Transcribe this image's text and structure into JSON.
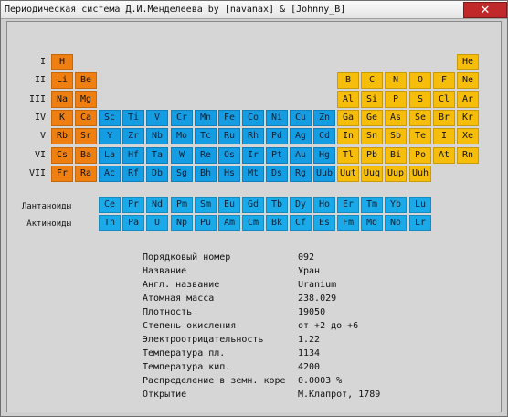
{
  "window": {
    "title": "Периодическая система Д.И.Менделеева by [navanax] & [Johnny_B]",
    "close_symbol": "✕",
    "colors": {
      "s_block": "#f07f11",
      "d_block": "#159de3",
      "p_block": "#f7bd0b",
      "f_block": "#1baae9",
      "close": "#c0282a"
    }
  },
  "period_labels": [
    "I",
    "II",
    "III",
    "IV",
    "V",
    "VI",
    "VII"
  ],
  "series_labels": {
    "lanthanides": "Лантаноиды",
    "actinides": "Актиноиды"
  },
  "elements": [
    {
      "symbol": "H",
      "period": 1,
      "group": 1,
      "block": "s"
    },
    {
      "symbol": "He",
      "period": 1,
      "group": 18,
      "block": "p"
    },
    {
      "symbol": "Li",
      "period": 2,
      "group": 1,
      "block": "s"
    },
    {
      "symbol": "Be",
      "period": 2,
      "group": 2,
      "block": "s"
    },
    {
      "symbol": "B",
      "period": 2,
      "group": 13,
      "block": "p"
    },
    {
      "symbol": "C",
      "period": 2,
      "group": 14,
      "block": "p"
    },
    {
      "symbol": "N",
      "period": 2,
      "group": 15,
      "block": "p"
    },
    {
      "symbol": "O",
      "period": 2,
      "group": 16,
      "block": "p"
    },
    {
      "symbol": "F",
      "period": 2,
      "group": 17,
      "block": "p"
    },
    {
      "symbol": "Ne",
      "period": 2,
      "group": 18,
      "block": "p"
    },
    {
      "symbol": "Na",
      "period": 3,
      "group": 1,
      "block": "s"
    },
    {
      "symbol": "Mg",
      "period": 3,
      "group": 2,
      "block": "s"
    },
    {
      "symbol": "Al",
      "period": 3,
      "group": 13,
      "block": "p"
    },
    {
      "symbol": "Si",
      "period": 3,
      "group": 14,
      "block": "p"
    },
    {
      "symbol": "P",
      "period": 3,
      "group": 15,
      "block": "p"
    },
    {
      "symbol": "S",
      "period": 3,
      "group": 16,
      "block": "p"
    },
    {
      "symbol": "Cl",
      "period": 3,
      "group": 17,
      "block": "p"
    },
    {
      "symbol": "Ar",
      "period": 3,
      "group": 18,
      "block": "p"
    },
    {
      "symbol": "K",
      "period": 4,
      "group": 1,
      "block": "s"
    },
    {
      "symbol": "Ca",
      "period": 4,
      "group": 2,
      "block": "s"
    },
    {
      "symbol": "Sc",
      "period": 4,
      "group": 3,
      "block": "d"
    },
    {
      "symbol": "Ti",
      "period": 4,
      "group": 4,
      "block": "d"
    },
    {
      "symbol": "V",
      "period": 4,
      "group": 5,
      "block": "d"
    },
    {
      "symbol": "Cr",
      "period": 4,
      "group": 6,
      "block": "d"
    },
    {
      "symbol": "Mn",
      "period": 4,
      "group": 7,
      "block": "d"
    },
    {
      "symbol": "Fe",
      "period": 4,
      "group": 8,
      "block": "d"
    },
    {
      "symbol": "Co",
      "period": 4,
      "group": 9,
      "block": "d"
    },
    {
      "symbol": "Ni",
      "period": 4,
      "group": 10,
      "block": "d"
    },
    {
      "symbol": "Cu",
      "period": 4,
      "group": 11,
      "block": "d"
    },
    {
      "symbol": "Zn",
      "period": 4,
      "group": 12,
      "block": "d"
    },
    {
      "symbol": "Ga",
      "period": 4,
      "group": 13,
      "block": "p"
    },
    {
      "symbol": "Ge",
      "period": 4,
      "group": 14,
      "block": "p"
    },
    {
      "symbol": "As",
      "period": 4,
      "group": 15,
      "block": "p"
    },
    {
      "symbol": "Se",
      "period": 4,
      "group": 16,
      "block": "p"
    },
    {
      "symbol": "Br",
      "period": 4,
      "group": 17,
      "block": "p"
    },
    {
      "symbol": "Kr",
      "period": 4,
      "group": 18,
      "block": "p"
    },
    {
      "symbol": "Rb",
      "period": 5,
      "group": 1,
      "block": "s"
    },
    {
      "symbol": "Sr",
      "period": 5,
      "group": 2,
      "block": "s"
    },
    {
      "symbol": "Y",
      "period": 5,
      "group": 3,
      "block": "d"
    },
    {
      "symbol": "Zr",
      "period": 5,
      "group": 4,
      "block": "d"
    },
    {
      "symbol": "Nb",
      "period": 5,
      "group": 5,
      "block": "d"
    },
    {
      "symbol": "Mo",
      "period": 5,
      "group": 6,
      "block": "d"
    },
    {
      "symbol": "Tc",
      "period": 5,
      "group": 7,
      "block": "d"
    },
    {
      "symbol": "Ru",
      "period": 5,
      "group": 8,
      "block": "d"
    },
    {
      "symbol": "Rh",
      "period": 5,
      "group": 9,
      "block": "d"
    },
    {
      "symbol": "Pd",
      "period": 5,
      "group": 10,
      "block": "d"
    },
    {
      "symbol": "Ag",
      "period": 5,
      "group": 11,
      "block": "d"
    },
    {
      "symbol": "Cd",
      "period": 5,
      "group": 12,
      "block": "d"
    },
    {
      "symbol": "In",
      "period": 5,
      "group": 13,
      "block": "p"
    },
    {
      "symbol": "Sn",
      "period": 5,
      "group": 14,
      "block": "p"
    },
    {
      "symbol": "Sb",
      "period": 5,
      "group": 15,
      "block": "p"
    },
    {
      "symbol": "Te",
      "period": 5,
      "group": 16,
      "block": "p"
    },
    {
      "symbol": "I",
      "period": 5,
      "group": 17,
      "block": "p"
    },
    {
      "symbol": "Xe",
      "period": 5,
      "group": 18,
      "block": "p"
    },
    {
      "symbol": "Cs",
      "period": 6,
      "group": 1,
      "block": "s"
    },
    {
      "symbol": "Ba",
      "period": 6,
      "group": 2,
      "block": "s"
    },
    {
      "symbol": "La",
      "period": 6,
      "group": 3,
      "block": "d"
    },
    {
      "symbol": "Hf",
      "period": 6,
      "group": 4,
      "block": "d"
    },
    {
      "symbol": "Ta",
      "period": 6,
      "group": 5,
      "block": "d"
    },
    {
      "symbol": "W",
      "period": 6,
      "group": 6,
      "block": "d"
    },
    {
      "symbol": "Re",
      "period": 6,
      "group": 7,
      "block": "d"
    },
    {
      "symbol": "Os",
      "period": 6,
      "group": 8,
      "block": "d"
    },
    {
      "symbol": "Ir",
      "period": 6,
      "group": 9,
      "block": "d"
    },
    {
      "symbol": "Pt",
      "period": 6,
      "group": 10,
      "block": "d"
    },
    {
      "symbol": "Au",
      "period": 6,
      "group": 11,
      "block": "d"
    },
    {
      "symbol": "Hg",
      "period": 6,
      "group": 12,
      "block": "d"
    },
    {
      "symbol": "Tl",
      "period": 6,
      "group": 13,
      "block": "p"
    },
    {
      "symbol": "Pb",
      "period": 6,
      "group": 14,
      "block": "p"
    },
    {
      "symbol": "Bi",
      "period": 6,
      "group": 15,
      "block": "p"
    },
    {
      "symbol": "Po",
      "period": 6,
      "group": 16,
      "block": "p"
    },
    {
      "symbol": "At",
      "period": 6,
      "group": 17,
      "block": "p"
    },
    {
      "symbol": "Rn",
      "period": 6,
      "group": 18,
      "block": "p"
    },
    {
      "symbol": "Fr",
      "period": 7,
      "group": 1,
      "block": "s"
    },
    {
      "symbol": "Ra",
      "period": 7,
      "group": 2,
      "block": "s"
    },
    {
      "symbol": "Ac",
      "period": 7,
      "group": 3,
      "block": "d"
    },
    {
      "symbol": "Rf",
      "period": 7,
      "group": 4,
      "block": "d"
    },
    {
      "symbol": "Db",
      "period": 7,
      "group": 5,
      "block": "d"
    },
    {
      "symbol": "Sg",
      "period": 7,
      "group": 6,
      "block": "d"
    },
    {
      "symbol": "Bh",
      "period": 7,
      "group": 7,
      "block": "d"
    },
    {
      "symbol": "Hs",
      "period": 7,
      "group": 8,
      "block": "d"
    },
    {
      "symbol": "Mt",
      "period": 7,
      "group": 9,
      "block": "d"
    },
    {
      "symbol": "Ds",
      "period": 7,
      "group": 10,
      "block": "d"
    },
    {
      "symbol": "Rg",
      "period": 7,
      "group": 11,
      "block": "d"
    },
    {
      "symbol": "Uub",
      "period": 7,
      "group": 12,
      "block": "d"
    },
    {
      "symbol": "Uut",
      "period": 7,
      "group": 13,
      "block": "p"
    },
    {
      "symbol": "Uuq",
      "period": 7,
      "group": 14,
      "block": "p"
    },
    {
      "symbol": "Uup",
      "period": 7,
      "group": 15,
      "block": "p"
    },
    {
      "symbol": "Uuh",
      "period": 7,
      "group": 16,
      "block": "p"
    }
  ],
  "lanthanides": [
    "Ce",
    "Pr",
    "Nd",
    "Pm",
    "Sm",
    "Eu",
    "Gd",
    "Tb",
    "Dy",
    "Ho",
    "Er",
    "Tm",
    "Yb",
    "Lu"
  ],
  "actinides": [
    "Th",
    "Pa",
    "U",
    "Np",
    "Pu",
    "Am",
    "Cm",
    "Bk",
    "Cf",
    "Es",
    "Fm",
    "Md",
    "No",
    "Lr"
  ],
  "info": [
    {
      "label": "Порядковый номер",
      "value": "092"
    },
    {
      "label": "Название",
      "value": "Уран"
    },
    {
      "label": "Англ. название",
      "value": "Uranium"
    },
    {
      "label": "Атомная масса",
      "value": "238.029"
    },
    {
      "label": "Плотность",
      "value": "19050"
    },
    {
      "label": "Степень окисления",
      "value": "от +2 до +6"
    },
    {
      "label": "Электроотрицательность",
      "value": "1.22"
    },
    {
      "label": "Температура пл.",
      "value": "1134"
    },
    {
      "label": "Температура кип.",
      "value": "4200"
    },
    {
      "label": "Распределение в земн. коре",
      "value": "0.0003 %"
    },
    {
      "label": "Открытие",
      "value": "М.Клапрот, 1789"
    }
  ]
}
